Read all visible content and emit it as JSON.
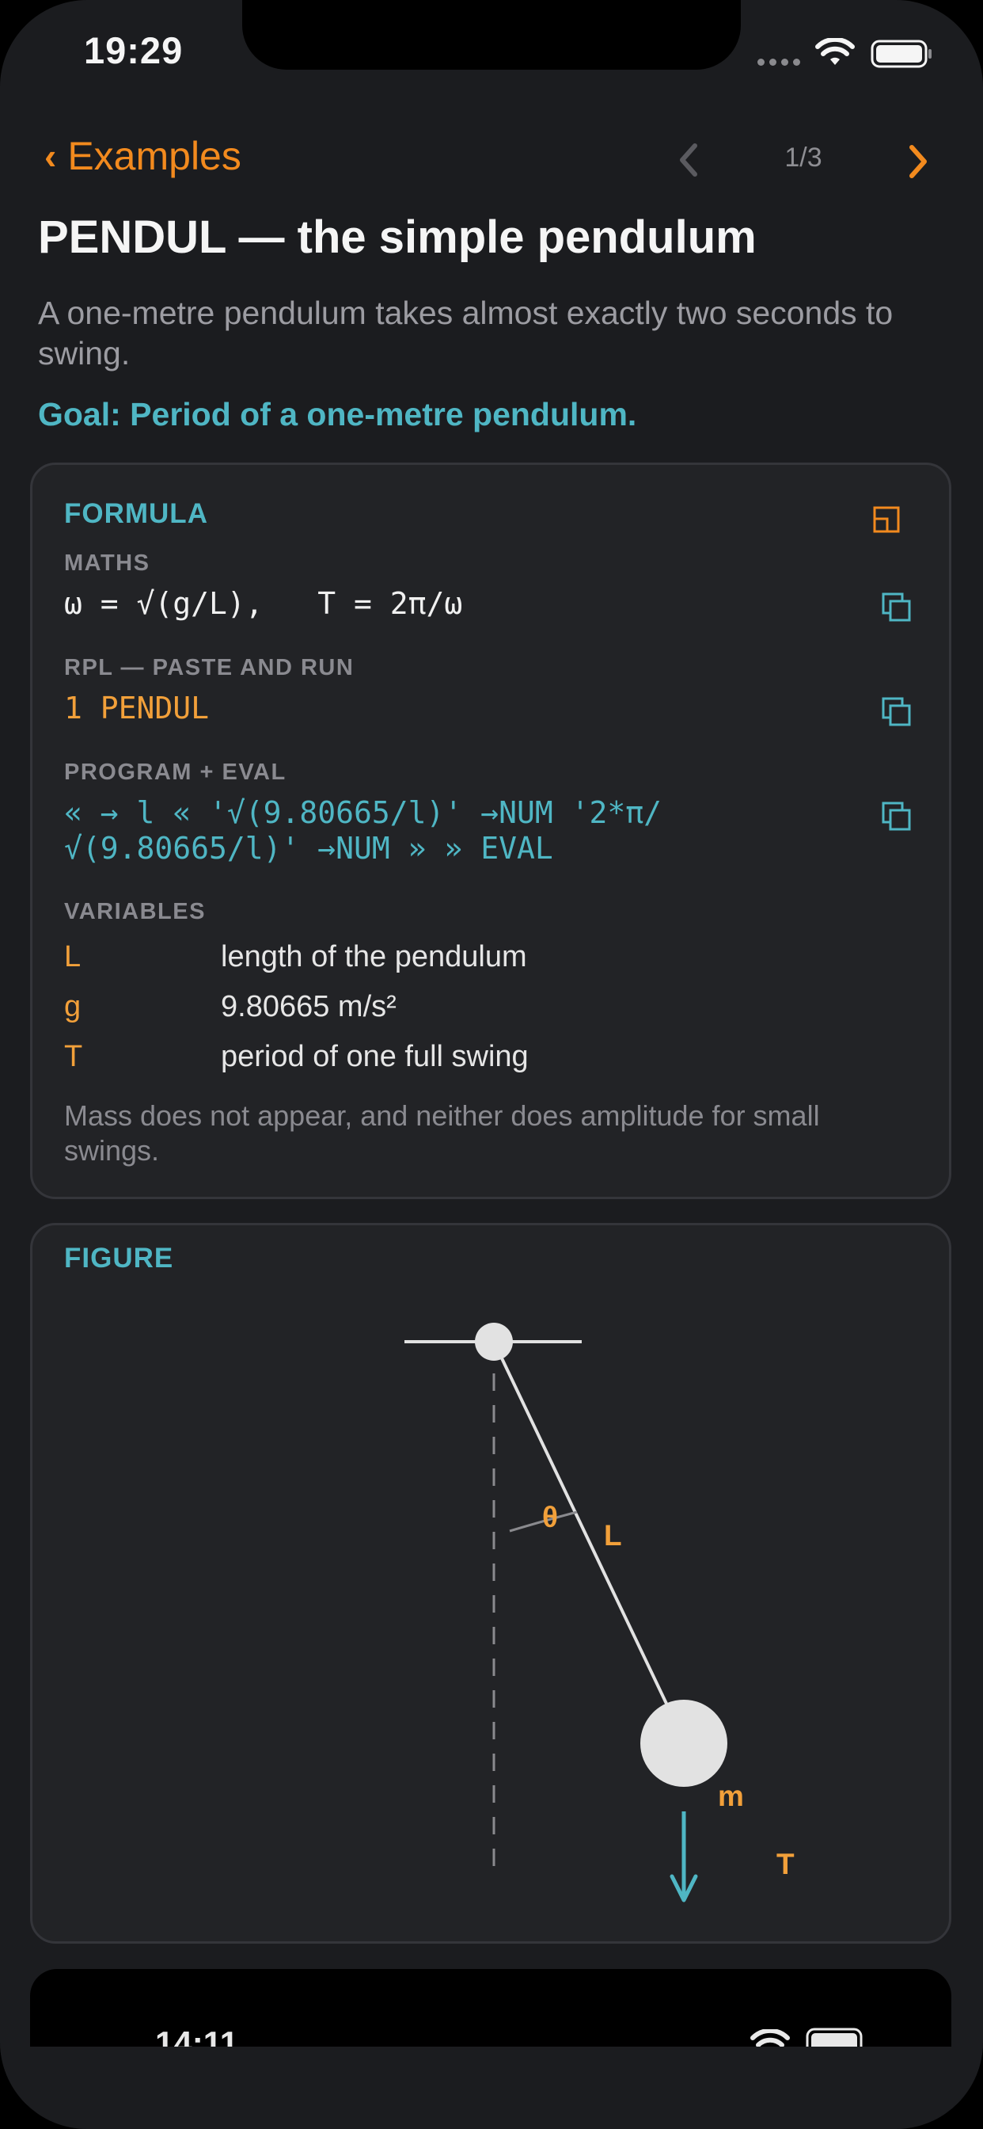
{
  "status_bar": {
    "time": "19:29"
  },
  "nav": {
    "back_label": "Examples",
    "page_indicator": "1/3"
  },
  "header": {
    "title": "PENDUL — the simple pendulum",
    "subtitle": "A one-metre pendulum takes almost exactly two seconds to swing.",
    "goal": "Goal: Period of a one-metre pendulum."
  },
  "formula_card": {
    "label": "FORMULA",
    "maths_label": "MATHS",
    "maths": "ω = √(g/L),   T = 2π/ω",
    "rpl_label": "RPL — PASTE AND RUN",
    "rpl": "1 PENDUL",
    "program_label": "PROGRAM + EVAL",
    "program_line1": "« → l « '√(9.80665/l)' →NUM '2*π/",
    "program_line2": "√(9.80665/l)' →NUM » » EVAL",
    "variables_label": "VARIABLES",
    "variables": [
      {
        "symbol": "L",
        "description": "length of the pendulum"
      },
      {
        "symbol": "g",
        "description": "9.80665 m/s²"
      },
      {
        "symbol": "T",
        "description": "period of one full swing"
      }
    ],
    "note": "Mass does not appear, and neither does amplitude for small swings."
  },
  "figure_card": {
    "label": "FIGURE",
    "labels": {
      "theta": "θ",
      "length": "L",
      "mass": "m",
      "period": "T"
    }
  },
  "preview": {
    "time": "14:11"
  },
  "colors": {
    "accent_orange": "#f28a1e",
    "accent_teal": "#4fb6c4",
    "background": "#1b1c1f",
    "card": "#222326"
  },
  "icons": [
    "back-chevron-icon",
    "prev-chevron-icon",
    "next-chevron-icon",
    "expand-icon",
    "copy-icon",
    "wifi-icon",
    "battery-icon",
    "cellular-signal-icon"
  ]
}
